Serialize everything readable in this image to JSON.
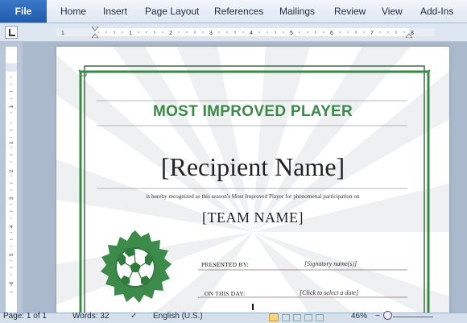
{
  "ribbon": {
    "file_label": "File",
    "tabs": [
      "Home",
      "Insert",
      "Page Layout",
      "References",
      "Mailings",
      "Review",
      "View",
      "Add-Ins"
    ]
  },
  "ruler": {
    "numbers": [
      "1",
      "1",
      "2",
      "3",
      "4",
      "5",
      "6",
      "7",
      "8",
      "9"
    ]
  },
  "certificate": {
    "title": "MOST IMPROVED PLAYER",
    "recipient": "[Recipient Name]",
    "subtitle": "is hereby recognized as this season's Most Improved Player for phenomenal participation on",
    "team": "[TEAM NAME]",
    "presented_label": "PRESENTED BY:",
    "presented_value": "[Signatory name(s)]",
    "date_label": "ON THIS DAY:",
    "date_value": "[Click to select a date]",
    "accent_color": "#3a8a47"
  },
  "statusbar": {
    "page": "Page: 1 of 1",
    "words": "Words: 32",
    "language": "English (U.S.)",
    "zoom": "46%"
  }
}
